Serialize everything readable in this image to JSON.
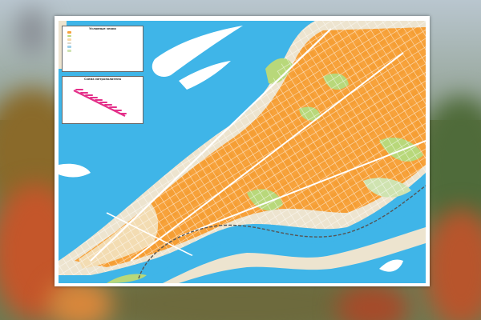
{
  "legend": {
    "title": "Условные знаки",
    "subtitle": "",
    "items": [
      {
        "label": "",
        "color": "#f7a23b"
      },
      {
        "label": "",
        "color": "#b8d87a"
      },
      {
        "label": "",
        "color": "#f6d9a8"
      },
      {
        "label": "",
        "color": "#d9d5c9"
      },
      {
        "label": "",
        "color": "#9ccfe9"
      },
      {
        "label": "",
        "color": "#cfe3b0"
      }
    ]
  },
  "metro": {
    "title": "Схема метрополитена",
    "line_color": "#e4308a",
    "stations": [
      "",
      "",
      "",
      "",
      "",
      "",
      "",
      "",
      "",
      ""
    ]
  },
  "colors": {
    "water": "#3fb5e8",
    "urban": "#f7a23b",
    "green": "#b8d87a",
    "land": "#ede4cf",
    "road": "#ffffff",
    "railway": "#555555"
  }
}
